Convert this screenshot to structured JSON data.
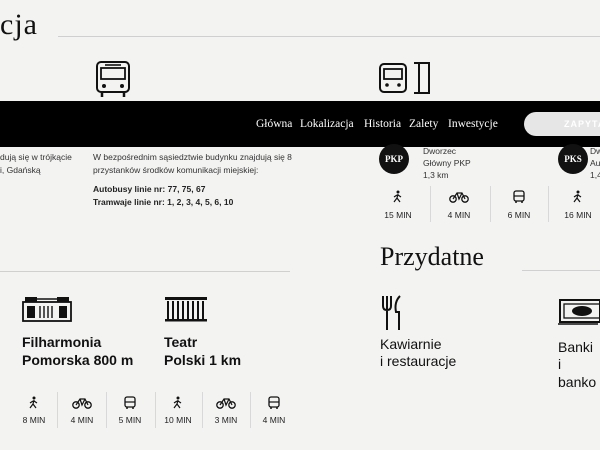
{
  "header": {
    "section_title_fragment": "cja",
    "useful_title": "Przydatne"
  },
  "nav": {
    "items": [
      "Główna",
      "Lokalizacja",
      "Historia",
      "Zalety",
      "Inwestycje"
    ],
    "cta": "ZAPYTA"
  },
  "left_snippet": {
    "line1": "dują się w trójkącie",
    "line2": "i, Gdańską"
  },
  "transport": {
    "desc_line1": "W bezpośrednim sąsiedztwie budynku znajdują się 8",
    "desc_line2": "przystanków środków komunikacji miejskiej:",
    "bus_lines": "Autobusy linie nr: 77, 75, 67",
    "tram_lines": "Tramwaje linie nr: 1, 2, 3, 4, 5, 6, 10"
  },
  "stations": [
    {
      "badge": "PKP",
      "line1": "Dworzec",
      "line2": "Główny PKP",
      "line3": "1,3 km"
    },
    {
      "badge": "PKS",
      "line1": "Dworzec",
      "line2": "Auto",
      "line3": "1,4"
    }
  ],
  "station_times": [
    "15 MIN",
    "4 MIN",
    "6 MIN",
    "16 MIN"
  ],
  "places": [
    {
      "line1": "Filharmonia",
      "line2": "Pomorska 800 m"
    },
    {
      "line1": "Teatr",
      "line2": "Polski 1 km"
    }
  ],
  "place_times": [
    "8 MIN",
    "4 MIN",
    "5 MIN",
    "10 MIN",
    "3 MIN",
    "4 MIN"
  ],
  "useful": [
    {
      "line1": "Kawiarnie",
      "line2": "i restauracje"
    },
    {
      "line1": "Banki",
      "line2": "i banko"
    }
  ],
  "colors": {
    "navbar": "#000000",
    "background": "#f3f3f2",
    "accent": "#111111"
  }
}
